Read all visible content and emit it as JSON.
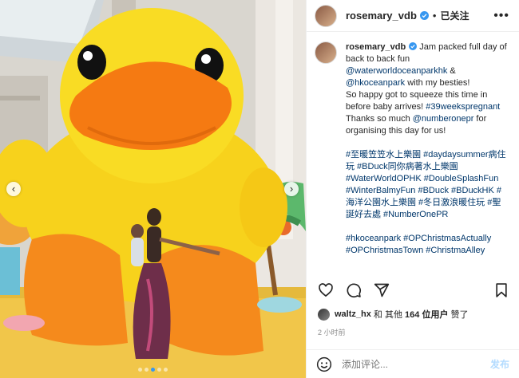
{
  "header": {
    "username": "rosemary_vdb",
    "separator": "•",
    "follow_status": "已关注",
    "more": "•••"
  },
  "caption": {
    "username": "rosemary_vdb",
    "line1": "Jam packed full day of back to back fun",
    "mention1": "@waterworldoceanparkhk",
    "and": " & ",
    "mention2": "@hkoceanpark",
    "line2": " with my besties!",
    "line3": "So happy got to squeeze this time in before baby arrives! ",
    "tag_weeks": "#39weekspregnant",
    "line4": "Thanks so much ",
    "mention3": "@numberonepr",
    "line5": " for organising this day for us!",
    "hashtags1": "#至暖笠笠水上樂園 #daydaysummer病住玩 #BDuck同你病著水上樂園 #WaterWorldOPHK #DoubleSplashFun #WinterBalmyFun #BDuck #BDuckHK #海洋公園水上樂園 #冬日激浪暖住玩 #聖誕好去處 #NumberOnePR",
    "hashtags2": "#hkoceanpark #OPChristmasActually #OPChristmasTown #ChristmaAlley"
  },
  "likes": {
    "user": "waltz_hx",
    "and_others": "和 其他",
    "count_text": "164 位用户",
    "liked": "赞了"
  },
  "timestamp": "2 小时前",
  "comment": {
    "placeholder": "添加评论...",
    "post_label": "发布"
  },
  "carousel": {
    "prev": "‹",
    "next": "›",
    "slide_count": 5,
    "active_index": 2
  },
  "icons": [
    "verified-badge-icon",
    "heart-icon",
    "comment-icon",
    "share-icon",
    "bookmark-icon",
    "emoji-icon"
  ],
  "colors": {
    "link": "#00376b",
    "accent": "#3797f0",
    "muted": "#8e8e8e",
    "post_disabled": "#b3dbff"
  }
}
